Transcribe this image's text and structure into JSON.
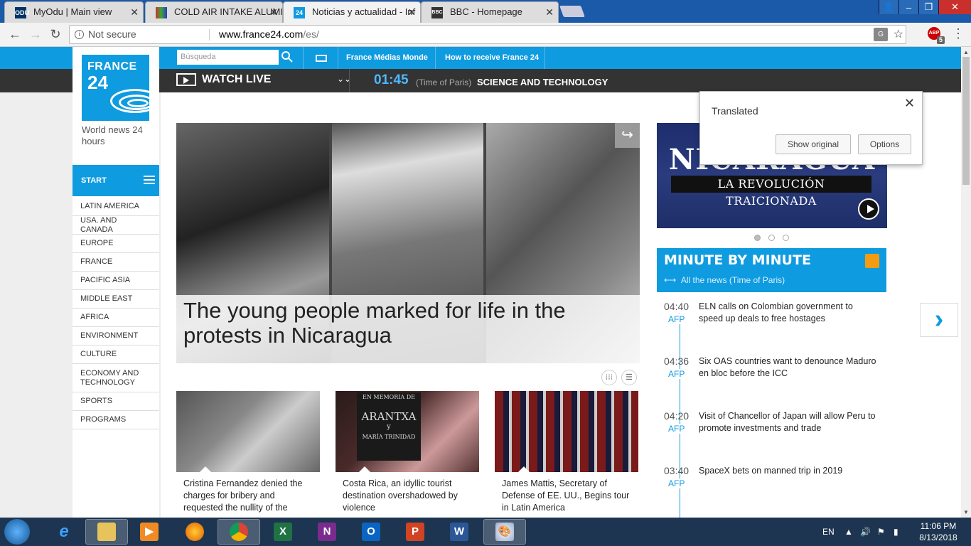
{
  "browser": {
    "tabs": [
      {
        "title": "MyOdu | Main view",
        "favicon": "odu",
        "favicon_color": "#003366"
      },
      {
        "title": "COLD AIR INTAKE ALUMI",
        "favicon": "multicolor",
        "favicon_color": "#cc3333"
      },
      {
        "title": "Noticias y actualidad - Inf",
        "favicon": "24",
        "favicon_color": "#0f9be0"
      },
      {
        "title": "BBC - Homepage",
        "favicon": "BBC",
        "favicon_color": "#333333"
      }
    ],
    "address": {
      "security": "Not secure",
      "url_host": "www.france24.com",
      "url_path": "/es/"
    },
    "extension_badge": "5",
    "abp_label": "ABP"
  },
  "site": {
    "logo_line1": "FRANCE",
    "logo_line2": "24",
    "tagline": "World news 24 hours",
    "search_placeholder": "Búsqueda",
    "top_links": [
      "France Médias Monde",
      "How to receive France 24"
    ],
    "watch_live": "WATCH LIVE",
    "live_time": "01:45",
    "time_of_paris": "(Time of Paris)",
    "program": "SCIENCE AND TECHNOLOGY",
    "start": "START",
    "nav": [
      "LATIN AMERICA",
      "USA. AND CANADA",
      "EUROPE",
      "FRANCE",
      "PACIFIC ASIA",
      "MIDDLE EAST",
      "AFRICA",
      "ENVIRONMENT",
      "CULTURE",
      "ECONOMY AND TECHNOLOGY",
      "SPORTS",
      "PROGRAMS"
    ],
    "hero_title": "The young people marked for life in the protests in Nicaragua",
    "cards": [
      {
        "text": "Cristina Fernandez denied the charges for bribery and requested the nullity of the"
      },
      {
        "text": "Costa Rica, an idyllic tourist destination overshadowed by violence"
      },
      {
        "text": "James Mattis, Secretary of Defense of EE. UU., Begins tour in Latin America"
      }
    ],
    "card2_sign": [
      "EN MEMORIA DE",
      "ARANTXA",
      "y",
      "MARÍA TRINIDAD"
    ],
    "promo_title": "NICARAGUA",
    "promo_sub": "LA REVOLUCIÓN TRAICIONADA",
    "mbm_title": "MINUTE BY MINUTE",
    "mbm_all": "All the news (Time of Paris)",
    "news": [
      {
        "time": "04:40",
        "src": "AFP",
        "text": "ELN calls on Colombian government to speed up deals to free hostages"
      },
      {
        "time": "04:36",
        "src": "AFP",
        "text": "Six OAS countries want to denounce Maduro en bloc before the ICC"
      },
      {
        "time": "04:20",
        "src": "AFP",
        "text": "Visit of Chancellor of Japan will allow Peru to promote investments and trade"
      },
      {
        "time": "03:40",
        "src": "AFP",
        "text": "SpaceX bets on manned trip in 2019"
      }
    ],
    "next_arrow": "›"
  },
  "translate_popup": {
    "title": "Translated",
    "show_original": "Show original",
    "options": "Options"
  },
  "taskbar": {
    "lang": "EN",
    "time": "11:06 PM",
    "date": "8/13/2018",
    "apps": [
      "internet-explorer",
      "file-explorer",
      "media-player",
      "firefox",
      "chrome",
      "excel",
      "onenote",
      "outlook",
      "powerpoint",
      "word",
      "paint"
    ]
  },
  "colors": {
    "brand": "#0f9be0",
    "dark": "#333333",
    "taskbar": "#1d3550"
  }
}
